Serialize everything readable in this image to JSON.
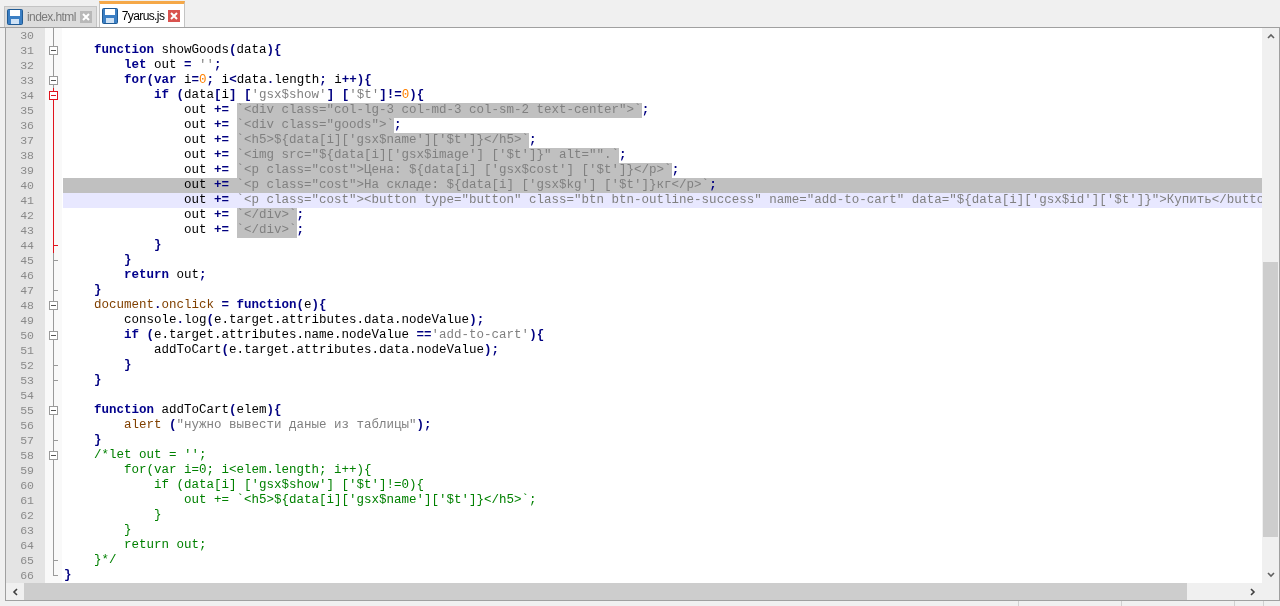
{
  "tabs": [
    {
      "label": "index.html",
      "selected": false
    },
    {
      "label": "7yarus.js",
      "selected": true
    }
  ],
  "editor": {
    "lines": [
      {
        "number": "30",
        "kind": "body",
        "selected": false,
        "caret": false
      },
      {
        "number": "31",
        "kind": "fold-start",
        "selected": false,
        "caret": false,
        "tokens": [
          {
            "kind": "kw",
            "text": "    function"
          },
          {
            "kind": "txt",
            "text": " showGoods"
          },
          {
            "kind": "op",
            "text": "("
          },
          {
            "kind": "txt",
            "text": "data"
          },
          {
            "kind": "op",
            "text": "){"
          }
        ]
      },
      {
        "number": "32",
        "kind": "body",
        "selected": false,
        "caret": false,
        "tokens": [
          {
            "kind": "kw",
            "text": "        let"
          },
          {
            "kind": "txt",
            "text": " out "
          },
          {
            "kind": "op",
            "text": "= "
          },
          {
            "kind": "str",
            "text": "''"
          },
          {
            "kind": "op",
            "text": ";"
          }
        ]
      },
      {
        "number": "33",
        "kind": "fold-start",
        "selected": false,
        "caret": false,
        "tokens": [
          {
            "kind": "kw",
            "text": "        for"
          },
          {
            "kind": "op",
            "text": "("
          },
          {
            "kind": "kw",
            "text": "var"
          },
          {
            "kind": "txt",
            "text": " i"
          },
          {
            "kind": "op",
            "text": "="
          },
          {
            "kind": "num",
            "text": "0"
          },
          {
            "kind": "op",
            "text": ";"
          },
          {
            "kind": "txt",
            "text": " i"
          },
          {
            "kind": "op",
            "text": "<"
          },
          {
            "kind": "txt",
            "text": "data"
          },
          {
            "kind": "op",
            "text": "."
          },
          {
            "kind": "txt",
            "text": "length"
          },
          {
            "kind": "op",
            "text": ";"
          },
          {
            "kind": "txt",
            "text": " i"
          },
          {
            "kind": "op",
            "text": "++){"
          }
        ]
      },
      {
        "number": "34",
        "kind": "fold-start-active",
        "selected": false,
        "caret": false,
        "tokens": [
          {
            "kind": "kw",
            "text": "            if "
          },
          {
            "kind": "op",
            "text": "("
          },
          {
            "kind": "txt",
            "text": "data"
          },
          {
            "kind": "op",
            "text": "["
          },
          {
            "kind": "txt",
            "text": "i"
          },
          {
            "kind": "op",
            "text": "] ["
          },
          {
            "kind": "str",
            "text": "'gsx$show'"
          },
          {
            "kind": "op",
            "text": "] ["
          },
          {
            "kind": "str",
            "text": "'$t'"
          },
          {
            "kind": "op",
            "text": "]!="
          },
          {
            "kind": "num",
            "text": "0"
          },
          {
            "kind": "op",
            "text": "){"
          }
        ]
      },
      {
        "number": "35",
        "kind": "body-active",
        "selected": false,
        "caret": false,
        "tokens": [
          {
            "kind": "txt",
            "text": "                out "
          },
          {
            "kind": "op",
            "text": "+= "
          },
          {
            "kind": "mark",
            "text": "`<div class=\"col-lg-3 col-md-3 col-sm-2 text-center\">`"
          },
          {
            "kind": "op",
            "text": ";"
          }
        ]
      },
      {
        "number": "36",
        "kind": "body-active",
        "selected": false,
        "caret": false,
        "tokens": [
          {
            "kind": "txt",
            "text": "                out "
          },
          {
            "kind": "op",
            "text": "+= "
          },
          {
            "kind": "mark",
            "text": "`<div class=\"goods\">`"
          },
          {
            "kind": "op",
            "text": ";"
          }
        ]
      },
      {
        "number": "37",
        "kind": "body-active",
        "selected": false,
        "caret": false,
        "tokens": [
          {
            "kind": "txt",
            "text": "                out "
          },
          {
            "kind": "op",
            "text": "+= "
          },
          {
            "kind": "mark",
            "text": "`<h5>${data[i]['gsx$name']['$t']}</h5>`"
          },
          {
            "kind": "op",
            "text": ";"
          }
        ]
      },
      {
        "number": "38",
        "kind": "body-active",
        "selected": false,
        "caret": false,
        "tokens": [
          {
            "kind": "txt",
            "text": "                out "
          },
          {
            "kind": "op",
            "text": "+= "
          },
          {
            "kind": "mark",
            "text": "`<img src=\"${data[i]['gsx$image'] ['$t']}\" alt=\"\".`"
          },
          {
            "kind": "op",
            "text": ";"
          }
        ]
      },
      {
        "number": "39",
        "kind": "body-active",
        "selected": false,
        "caret": false,
        "tokens": [
          {
            "kind": "txt",
            "text": "                out "
          },
          {
            "kind": "op",
            "text": "+= "
          },
          {
            "kind": "mark",
            "text": "`<p class=\"cost\">Цена: ${data[i] ['gsx$cost'] ['$t']}</p>`"
          },
          {
            "kind": "op",
            "text": ";"
          }
        ]
      },
      {
        "number": "40",
        "kind": "body-active",
        "selected": true,
        "caret": false,
        "tokens": [
          {
            "kind": "txt",
            "text": "                out "
          },
          {
            "kind": "op",
            "text": "+= "
          },
          {
            "kind": "mark",
            "text": "`<p class=\"cost\">На складе: ${data[i] ['gsx$kg'] ['$t']}кг</p>`"
          },
          {
            "kind": "op",
            "text": ";"
          }
        ]
      },
      {
        "number": "41",
        "kind": "body-active",
        "selected": false,
        "caret": true,
        "tokens": [
          {
            "kind": "txt",
            "text": "                out "
          },
          {
            "kind": "op",
            "text": "+= "
          },
          {
            "kind": "str",
            "text": "`<p class=\"cost\"><button type=\"button\" class=\"btn btn-outline-success\" name=\"add-to-cart\" data=\"${data[i]['gsx$id']['$t']}\">Купить</butto"
          }
        ]
      },
      {
        "number": "42",
        "kind": "body-active",
        "selected": false,
        "caret": false,
        "tokens": [
          {
            "kind": "txt",
            "text": "                out "
          },
          {
            "kind": "op",
            "text": "+= "
          },
          {
            "kind": "mark",
            "text": "`</div>`"
          },
          {
            "kind": "op",
            "text": ";"
          }
        ]
      },
      {
        "number": "43",
        "kind": "body-active",
        "selected": false,
        "caret": false,
        "tokens": [
          {
            "kind": "txt",
            "text": "                out "
          },
          {
            "kind": "op",
            "text": "+= "
          },
          {
            "kind": "mark",
            "text": "`</div>`"
          },
          {
            "kind": "op",
            "text": ";"
          }
        ]
      },
      {
        "number": "44",
        "kind": "fold-end-active",
        "selected": false,
        "caret": false,
        "tokens": [
          {
            "kind": "op",
            "text": "            }"
          }
        ]
      },
      {
        "number": "45",
        "kind": "fold-end",
        "selected": false,
        "caret": false,
        "tokens": [
          {
            "kind": "op",
            "text": "        }"
          }
        ]
      },
      {
        "number": "46",
        "kind": "body",
        "selected": false,
        "caret": false,
        "tokens": [
          {
            "kind": "kw",
            "text": "        return"
          },
          {
            "kind": "txt",
            "text": " out"
          },
          {
            "kind": "op",
            "text": ";"
          }
        ]
      },
      {
        "number": "47",
        "kind": "fold-end",
        "selected": false,
        "caret": false,
        "tokens": [
          {
            "kind": "op",
            "text": "    }"
          }
        ]
      },
      {
        "number": "48",
        "kind": "fold-start",
        "selected": false,
        "caret": false,
        "tokens": [
          {
            "kind": "obj",
            "text": "    document"
          },
          {
            "kind": "op",
            "text": "."
          },
          {
            "kind": "obj",
            "text": "onclick"
          },
          {
            "kind": "op",
            "text": " = "
          },
          {
            "kind": "kw",
            "text": "function"
          },
          {
            "kind": "op",
            "text": "("
          },
          {
            "kind": "txt",
            "text": "e"
          },
          {
            "kind": "op",
            "text": "){"
          }
        ]
      },
      {
        "number": "49",
        "kind": "body",
        "selected": false,
        "caret": false,
        "tokens": [
          {
            "kind": "txt",
            "text": "        console"
          },
          {
            "kind": "op",
            "text": "."
          },
          {
            "kind": "txt",
            "text": "log"
          },
          {
            "kind": "op",
            "text": "("
          },
          {
            "kind": "txt",
            "text": "e.target.attributes.data.nodeValue"
          },
          {
            "kind": "op",
            "text": ");"
          }
        ]
      },
      {
        "number": "50",
        "kind": "fold-start",
        "selected": false,
        "caret": false,
        "tokens": [
          {
            "kind": "kw",
            "text": "        if "
          },
          {
            "kind": "op",
            "text": "("
          },
          {
            "kind": "txt",
            "text": "e.target.attributes.name.nodeValue "
          },
          {
            "kind": "op",
            "text": "=="
          },
          {
            "kind": "str",
            "text": "'add-to-cart'"
          },
          {
            "kind": "op",
            "text": "){"
          }
        ]
      },
      {
        "number": "51",
        "kind": "body",
        "selected": false,
        "caret": false,
        "tokens": [
          {
            "kind": "txt",
            "text": "            addToCart"
          },
          {
            "kind": "op",
            "text": "("
          },
          {
            "kind": "txt",
            "text": "e.target.attributes.data.nodeValue"
          },
          {
            "kind": "op",
            "text": ");"
          }
        ]
      },
      {
        "number": "52",
        "kind": "fold-end",
        "selected": false,
        "caret": false,
        "tokens": [
          {
            "kind": "op",
            "text": "        }"
          }
        ]
      },
      {
        "number": "53",
        "kind": "fold-end",
        "selected": false,
        "caret": false,
        "tokens": [
          {
            "kind": "op",
            "text": "    }"
          }
        ]
      },
      {
        "number": "54",
        "kind": "body",
        "selected": false,
        "caret": false
      },
      {
        "number": "55",
        "kind": "fold-start",
        "selected": false,
        "caret": false,
        "tokens": [
          {
            "kind": "kw",
            "text": "    function"
          },
          {
            "kind": "txt",
            "text": " addToCart"
          },
          {
            "kind": "op",
            "text": "("
          },
          {
            "kind": "txt",
            "text": "elem"
          },
          {
            "kind": "op",
            "text": "){"
          }
        ]
      },
      {
        "number": "56",
        "kind": "body",
        "selected": false,
        "caret": false,
        "tokens": [
          {
            "kind": "obj",
            "text": "        alert"
          },
          {
            "kind": "op",
            "text": " ("
          },
          {
            "kind": "str",
            "text": "\"нужно вывести даные из таблицы\""
          },
          {
            "kind": "op",
            "text": ");"
          }
        ]
      },
      {
        "number": "57",
        "kind": "fold-end",
        "selected": false,
        "caret": false,
        "tokens": [
          {
            "kind": "op",
            "text": "    }"
          }
        ]
      },
      {
        "number": "58",
        "kind": "fold-start",
        "selected": false,
        "caret": false,
        "tokens": [
          {
            "kind": "cmt",
            "text": "    /*let out = '';"
          }
        ]
      },
      {
        "number": "59",
        "kind": "body",
        "selected": false,
        "caret": false,
        "tokens": [
          {
            "kind": "cmt",
            "text": "        for(var i=0; i<elem.length; i++){"
          }
        ]
      },
      {
        "number": "60",
        "kind": "body",
        "selected": false,
        "caret": false,
        "tokens": [
          {
            "kind": "cmt",
            "text": "            if (data[i] ['gsx$show'] ['$t']!=0){"
          }
        ]
      },
      {
        "number": "61",
        "kind": "body",
        "selected": false,
        "caret": false,
        "tokens": [
          {
            "kind": "cmt",
            "text": "                out += `<h5>${data[i]['gsx$name']['$t']}</h5>`;"
          }
        ]
      },
      {
        "number": "62",
        "kind": "body",
        "selected": false,
        "caret": false,
        "tokens": [
          {
            "kind": "cmt",
            "text": "            }"
          }
        ]
      },
      {
        "number": "63",
        "kind": "body",
        "selected": false,
        "caret": false,
        "tokens": [
          {
            "kind": "cmt",
            "text": "        }"
          }
        ]
      },
      {
        "number": "64",
        "kind": "body",
        "selected": false,
        "caret": false,
        "tokens": [
          {
            "kind": "cmt",
            "text": "        return out;"
          }
        ]
      },
      {
        "number": "65",
        "kind": "fold-end",
        "selected": false,
        "caret": false,
        "tokens": [
          {
            "kind": "cmt",
            "text": "    }*/"
          }
        ]
      },
      {
        "number": "66",
        "kind": "last",
        "selected": false,
        "caret": false,
        "tokens": [
          {
            "kind": "op",
            "text": "}"
          }
        ]
      }
    ]
  }
}
